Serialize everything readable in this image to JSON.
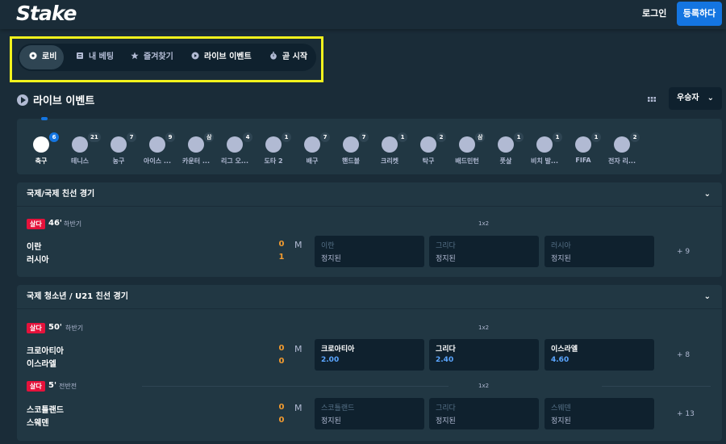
{
  "header": {
    "logo": "Stake",
    "login": "로그인",
    "register": "등록하다"
  },
  "tabs": [
    {
      "label": "로비",
      "icon": "lobby-icon",
      "active": true
    },
    {
      "label": "내 베팅",
      "icon": "bets-icon",
      "active": false
    },
    {
      "label": "즐겨찾기",
      "icon": "star-icon",
      "active": false
    },
    {
      "label": "라이브 이벤트",
      "icon": "play-icon",
      "active": false
    },
    {
      "label": "곧 시작",
      "icon": "stopwatch-icon",
      "active": false
    }
  ],
  "section": {
    "title": "라이브 이벤트",
    "sort_label": "우승자"
  },
  "sports": [
    {
      "label": "축구",
      "count": "6",
      "active": true
    },
    {
      "label": "테니스",
      "count": "21"
    },
    {
      "label": "농구",
      "count": "7"
    },
    {
      "label": "아이스 ...",
      "count": "9"
    },
    {
      "label": "카운터 ...",
      "count": "삼"
    },
    {
      "label": "리그 오...",
      "count": "4"
    },
    {
      "label": "도타 2",
      "count": "1"
    },
    {
      "label": "배구",
      "count": "7"
    },
    {
      "label": "핸드볼",
      "count": "7"
    },
    {
      "label": "크리켓",
      "count": "1"
    },
    {
      "label": "탁구",
      "count": "2"
    },
    {
      "label": "배드민턴",
      "count": "삼"
    },
    {
      "label": "풋살",
      "count": "1"
    },
    {
      "label": "비치 발...",
      "count": "1"
    },
    {
      "label": "FIFA",
      "count": "1"
    },
    {
      "label": "전자 리...",
      "count": "2"
    }
  ],
  "leagues": [
    {
      "name": "국제/국제 친선 경기",
      "matches": [
        {
          "live": "살다",
          "minute": "46'",
          "period": "하반기",
          "market": "1x2",
          "team1": "이란",
          "team2": "러시아",
          "score1": "0",
          "score2": "1",
          "odds": [
            {
              "name": "이란",
              "value": "정지된"
            },
            {
              "name": "그리다",
              "value": "정지된"
            },
            {
              "name": "러시아",
              "value": "정지된"
            }
          ],
          "more": "+ 9"
        }
      ]
    },
    {
      "name": "국제 청소년 / U21 친선 경기",
      "matches": [
        {
          "live": "살다",
          "minute": "50'",
          "period": "하반기",
          "market": "1x2",
          "team1": "크로아티아",
          "team2": "이스라엘",
          "score1": "0",
          "score2": "0",
          "odds": [
            {
              "name": "크로아티아",
              "value": "2.00"
            },
            {
              "name": "그리다",
              "value": "2.40"
            },
            {
              "name": "이스라엘",
              "value": "4.60"
            }
          ],
          "more": "+ 8"
        },
        {
          "live": "살다",
          "minute": "5'",
          "period": "전반전",
          "market": "1x2",
          "team1": "스코틀랜드",
          "team2": "스웨덴",
          "score1": "0",
          "score2": "0",
          "odds": [
            {
              "name": "스코틀랜드",
              "value": "정지된"
            },
            {
              "name": "그리다",
              "value": "정지된"
            },
            {
              "name": "스웨덴",
              "value": "정지된"
            }
          ],
          "more": "+ 13"
        }
      ]
    }
  ]
}
